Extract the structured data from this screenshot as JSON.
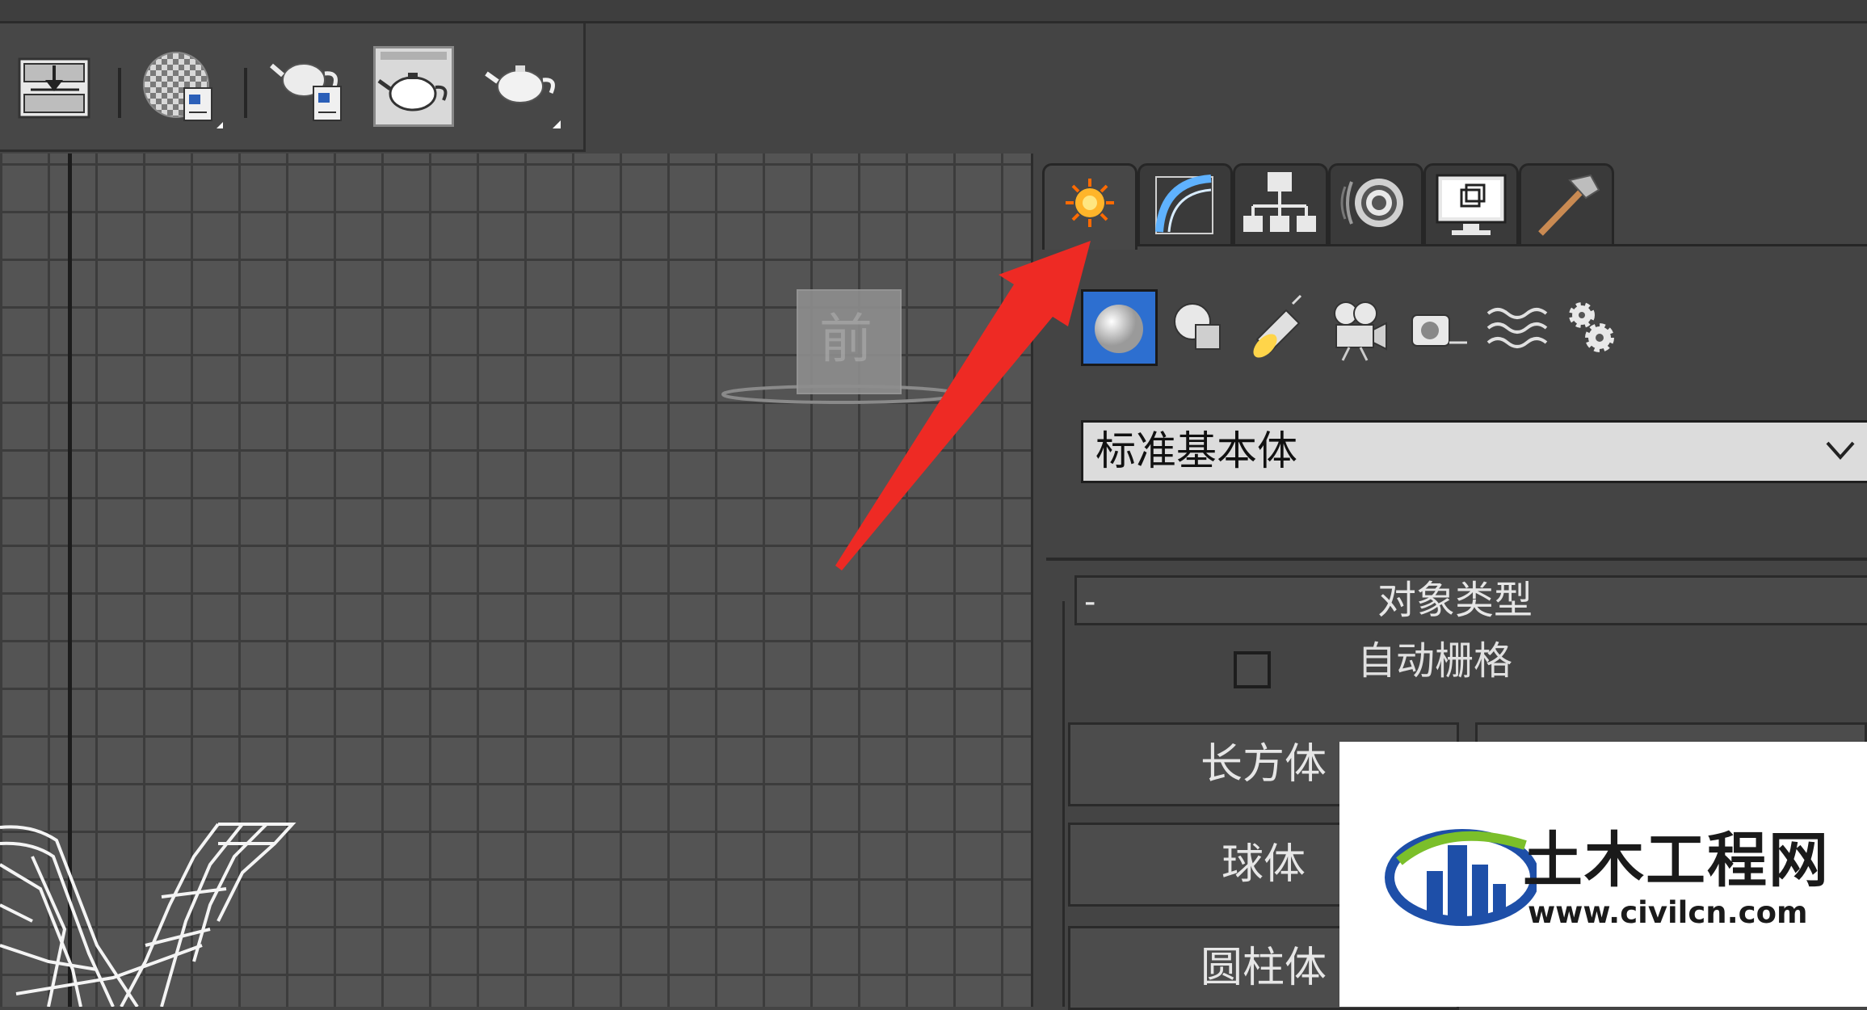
{
  "toolbar": {
    "buttons": [
      {
        "name": "render-setup",
        "icon": "render-setup-icon"
      },
      {
        "name": "material-editor",
        "icon": "material-sphere-icon"
      },
      {
        "name": "rendered-frame-window",
        "icon": "teapot-frame-icon"
      },
      {
        "name": "render-production",
        "icon": "teapot-icon"
      },
      {
        "name": "render-iterative",
        "icon": "teapot-dropdown-icon"
      }
    ]
  },
  "viewport": {
    "viewcube_label": "前"
  },
  "command_panel": {
    "tabs": [
      "create",
      "modify",
      "hierarchy",
      "motion",
      "display",
      "utilities"
    ],
    "active_tab": "create",
    "categories": [
      "geometry",
      "shapes",
      "lights",
      "cameras",
      "helpers",
      "space-warps",
      "systems"
    ],
    "dropdown": {
      "value": "标准基本体"
    },
    "rollout": {
      "toggle": "-",
      "title": "对象类型",
      "autogrid_label": "自动栅格",
      "buttons": [
        "长方体",
        "球体",
        "圆柱体"
      ]
    }
  },
  "watermark": {
    "brand": "土木工程网",
    "url": "www.civilcn.com"
  },
  "colors": {
    "panel_bg": "#444444",
    "viewport_bg": "#545454",
    "grid_line": "#3c3c3c",
    "arrow": "#ee2a24",
    "active_category": "#2d6fd0"
  }
}
